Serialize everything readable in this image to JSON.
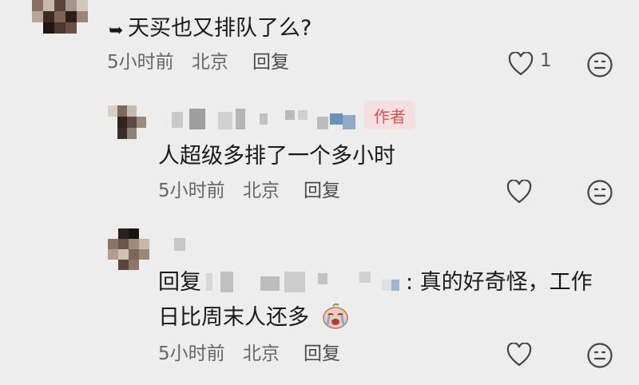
{
  "comments": [
    {
      "text": "天买也又排队了么?",
      "time": "5小时前",
      "location": "北京",
      "reply_label": "回复",
      "like_count": "1"
    },
    {
      "author_tag": "作者",
      "text": "人超级多排了一个多小时",
      "time": "5小时前",
      "location": "北京",
      "reply_label": "回复"
    },
    {
      "reply_prefix": "回复",
      "reply_body": ": 真的好奇怪，工作",
      "text_line2": "日比周末人还多",
      "time": "5小时前",
      "location": "北京",
      "reply_label": "回复"
    }
  ],
  "colors": {
    "background": "#ededed",
    "author_tag_bg": "#f5dfe0",
    "author_tag_text": "#d9534f"
  },
  "icons": [
    "heart-outline-icon",
    "emoji-face-icon",
    "crying-face-emoji"
  ]
}
